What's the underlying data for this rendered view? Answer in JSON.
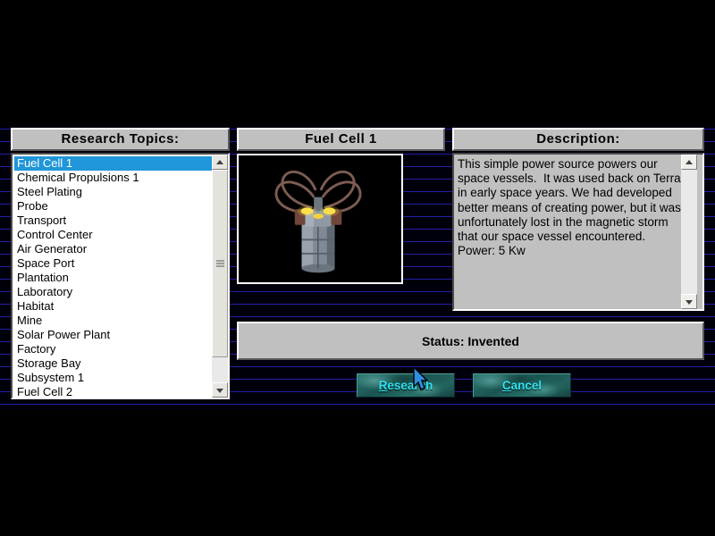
{
  "panels": {
    "topics_header": "Research Topics:",
    "center_header": "Fuel Cell 1",
    "description_header": "Description:"
  },
  "topics": {
    "selected": "Fuel Cell 1",
    "items": [
      "Fuel Cell 1",
      "Chemical Propulsions 1",
      "Steel Plating",
      "Probe",
      "Transport",
      "Control Center",
      "Air Generator",
      "Space Port",
      "Plantation",
      "Laboratory",
      "Habitat",
      "Mine",
      "Solar Power Plant",
      "Factory",
      "Storage Bay",
      "Subsystem 1",
      "Fuel Cell 2"
    ]
  },
  "description": {
    "text": "This simple power source powers our space vessels.  It was used back on Terra in early space years. We had developed better means of creating power, but it was unfortunately lost in the magnetic storm that our space vessel encountered.  Power: 5 Kw"
  },
  "status": {
    "label": "Status: Invented"
  },
  "buttons": {
    "research": {
      "accel": "R",
      "rest": "esearch"
    },
    "cancel": {
      "accel": "C",
      "rest": "ancel"
    }
  },
  "preview": {
    "alt": "fuel-cell-render"
  },
  "colors": {
    "selection_blue": "#2196d8",
    "scanline_blue": "#221fa8",
    "panel_face": "#c0c0c0",
    "button_teal": "#1f5f5c",
    "button_text_cyan": "#30e0f0",
    "background_black": "#000000"
  }
}
